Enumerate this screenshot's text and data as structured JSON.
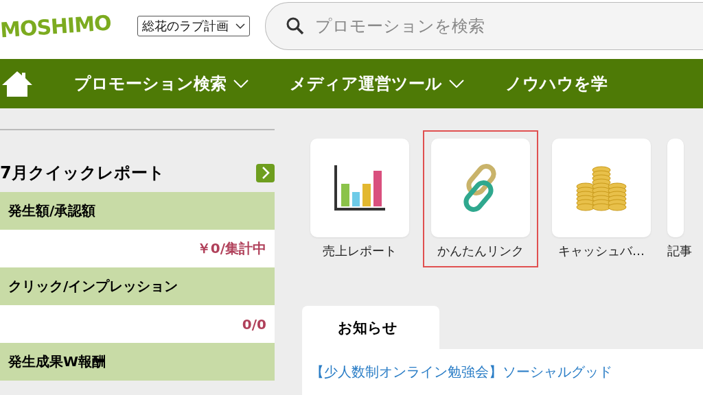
{
  "header": {
    "logo": "MOSHIMO",
    "site_select": {
      "value": "総花のラブ計画"
    },
    "search": {
      "placeholder": "プロモーションを検索"
    }
  },
  "nav": {
    "items": [
      {
        "label": "プロモーション検索",
        "dropdown": true
      },
      {
        "label": "メディア運営ツール",
        "dropdown": true
      },
      {
        "label": "ノウハウを学",
        "dropdown": false
      }
    ]
  },
  "quick_report": {
    "title": "7月クイックレポート",
    "rows": [
      {
        "label": "発生額/承認額",
        "value": "￥0/集計中"
      },
      {
        "label": "クリック/インプレッション",
        "value": "0/0"
      },
      {
        "label": "発生成果W報酬"
      }
    ]
  },
  "shortcuts": [
    {
      "kind": "chart",
      "label": "売上レポート",
      "highlighted": false
    },
    {
      "kind": "link",
      "label": "かんたんリンク",
      "highlighted": true
    },
    {
      "kind": "coins",
      "label": "キャッシュバ…",
      "highlighted": false
    },
    {
      "kind": "blank",
      "label": "記事",
      "highlighted": false
    }
  ],
  "news": {
    "tab": "お知らせ",
    "items": [
      "【少人数制オンライン勉強会】ソーシャルグッド"
    ]
  }
}
